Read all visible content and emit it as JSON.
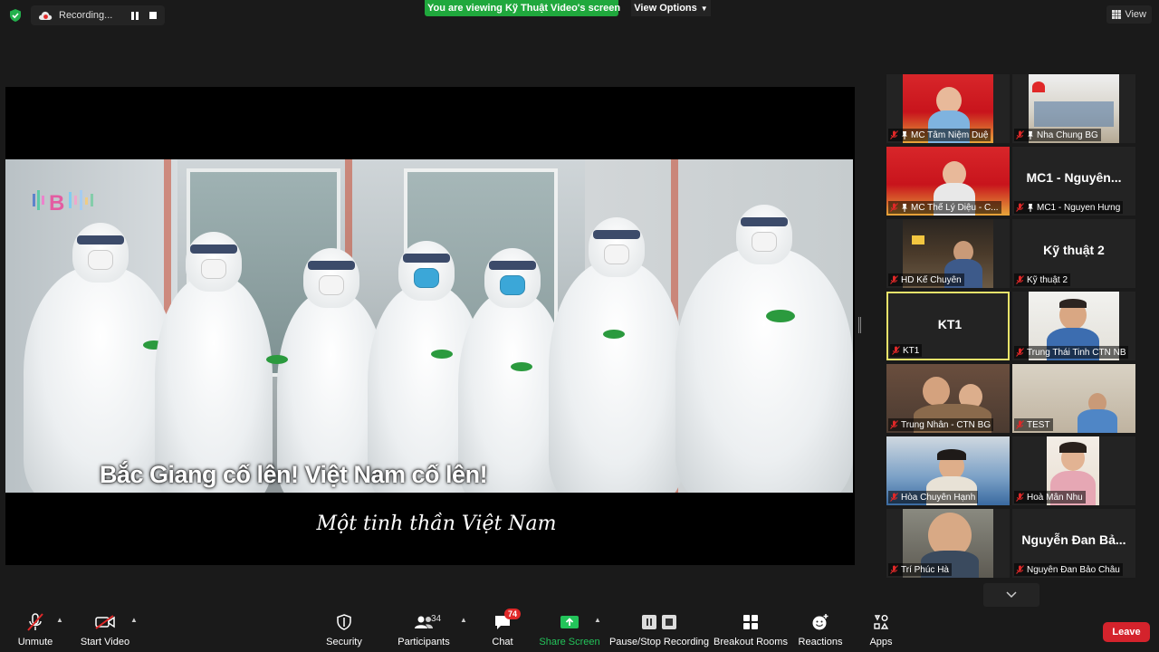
{
  "top_bar": {
    "recording_label": "Recording...",
    "viewing_banner": "You are viewing Kỹ Thuật Video's screen",
    "view_options_label": "View Options",
    "view_label": "View"
  },
  "shared_screen": {
    "subtitle": "Bắc Giang cố lên! Việt Nam cố lên!",
    "caption": "Một tinh thần Việt Nam"
  },
  "gallery": [
    {
      "label": "MC Tâm Niệm Duệ",
      "pinned": true,
      "muted": true,
      "video": true,
      "display_name": ""
    },
    {
      "label": "Nha Chung BG",
      "pinned": true,
      "muted": true,
      "video": true,
      "display_name": ""
    },
    {
      "label": "MC Thế Lý Diệu - C...",
      "pinned": true,
      "muted": true,
      "video": true,
      "display_name": ""
    },
    {
      "label": "MC1 - Nguyen Hưng",
      "pinned": true,
      "muted": true,
      "video": false,
      "display_name": "MC1 - Nguyên..."
    },
    {
      "label": "HD Kế Chuyên",
      "pinned": false,
      "muted": true,
      "video": true,
      "display_name": ""
    },
    {
      "label": "Kỹ thuật 2",
      "pinned": false,
      "muted": true,
      "video": false,
      "display_name": "Kỹ thuật 2"
    },
    {
      "label": "KT1",
      "pinned": false,
      "muted": true,
      "video": false,
      "display_name": "KT1",
      "active": true
    },
    {
      "label": "Trung Thái Tinh CTN NB",
      "pinned": false,
      "muted": true,
      "video": true,
      "display_name": ""
    },
    {
      "label": "Trung Nhân - CTN BG",
      "pinned": false,
      "muted": true,
      "video": true,
      "display_name": ""
    },
    {
      "label": "TEST",
      "pinned": false,
      "muted": true,
      "video": true,
      "display_name": ""
    },
    {
      "label": "Hòa Chuyên Hạnh",
      "pinned": false,
      "muted": true,
      "video": true,
      "display_name": ""
    },
    {
      "label": "Hoà Mẫn Nhu",
      "pinned": false,
      "muted": true,
      "video": true,
      "display_name": ""
    },
    {
      "label": "Trí Phúc Hà",
      "pinned": false,
      "muted": true,
      "video": true,
      "display_name": ""
    },
    {
      "label": "Nguyễn Đan Bảo Châu",
      "pinned": false,
      "muted": true,
      "video": false,
      "display_name": "Nguyễn Đan Bả..."
    }
  ],
  "toolbar": {
    "unmute": "Unmute",
    "start_video": "Start Video",
    "security": "Security",
    "participants": "Participants",
    "participants_count": "34",
    "chat": "Chat",
    "chat_badge": "74",
    "share_screen": "Share Screen",
    "pause_recording": "Pause/Stop Recording",
    "breakout": "Breakout Rooms",
    "reactions": "Reactions",
    "apps": "Apps",
    "leave": "Leave"
  },
  "colors": {
    "banner_green": "#20a83d",
    "share_green": "#23c35a",
    "leave_red": "#d4232c",
    "badge_red": "#e02828",
    "active_border": "#e8e36a"
  }
}
